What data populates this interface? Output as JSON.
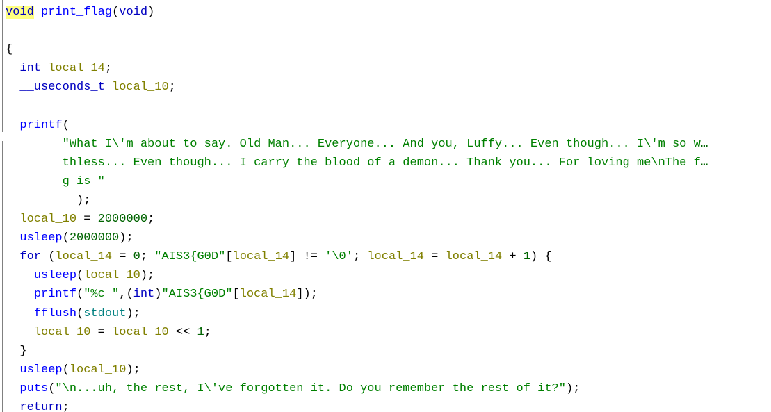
{
  "view": {
    "name": "decompiled-function-listing",
    "language": "c",
    "background_color": "#ffffff",
    "highlight_color": "#ffff80",
    "guide_rail_color": "#808080"
  },
  "colors": {
    "keyword": "#0000c0",
    "function": "#0000ff",
    "variable": "#808000",
    "string": "#008000",
    "number": "#006400",
    "global": "#008080",
    "punctuation": "#000000"
  },
  "function": {
    "return_type": "void",
    "name": "print_flag",
    "parameters": "(void)"
  },
  "lines": [
    {
      "index": 0,
      "indent": 0,
      "tokens": [
        {
          "t": "void",
          "c": "kw",
          "hl": true
        },
        {
          "t": " ",
          "c": "punct"
        },
        {
          "t": "print_flag",
          "c": "fn"
        },
        {
          "t": "(",
          "c": "punct"
        },
        {
          "t": "void",
          "c": "kw"
        },
        {
          "t": ")",
          "c": "punct"
        }
      ]
    },
    {
      "index": 1,
      "indent": 0,
      "tokens": []
    },
    {
      "index": 2,
      "indent": 0,
      "tokens": [
        {
          "t": "{",
          "c": "punct"
        }
      ]
    },
    {
      "index": 3,
      "indent": 1,
      "tokens": [
        {
          "t": "int",
          "c": "kw"
        },
        {
          "t": " ",
          "c": "punct"
        },
        {
          "t": "local_14",
          "c": "var"
        },
        {
          "t": ";",
          "c": "punct"
        }
      ]
    },
    {
      "index": 4,
      "indent": 1,
      "tokens": [
        {
          "t": "__useconds_t",
          "c": "kw"
        },
        {
          "t": " ",
          "c": "punct"
        },
        {
          "t": "local_10",
          "c": "var"
        },
        {
          "t": ";",
          "c": "punct"
        }
      ]
    },
    {
      "index": 5,
      "indent": 0,
      "tokens": []
    },
    {
      "index": 6,
      "indent": 1,
      "tokens": [
        {
          "t": "printf",
          "c": "fn"
        },
        {
          "t": "(",
          "c": "punct"
        }
      ]
    },
    {
      "index": 7,
      "indent": 4,
      "tokens": [
        {
          "t": "\"What I\\'m about to say. Old Man... Everyone... And you, Luffy... Even though... I\\'m so w",
          "c": "str"
        },
        {
          "t": "…",
          "c": "ellipsis"
        }
      ]
    },
    {
      "index": 8,
      "indent": 4,
      "tokens": [
        {
          "t": "thless... Even though... I carry the blood of a demon... Thank you... For loving me\\nThe f",
          "c": "str"
        },
        {
          "t": "…",
          "c": "ellipsis"
        }
      ]
    },
    {
      "index": 9,
      "indent": 4,
      "tokens": [
        {
          "t": "g is \"",
          "c": "str"
        }
      ]
    },
    {
      "index": 10,
      "indent": 5,
      "tokens": [
        {
          "t": ")",
          "c": "punct"
        },
        {
          "t": ";",
          "c": "punct"
        }
      ]
    },
    {
      "index": 11,
      "indent": 1,
      "tokens": [
        {
          "t": "local_10",
          "c": "var"
        },
        {
          "t": " = ",
          "c": "punct"
        },
        {
          "t": "2000000",
          "c": "num"
        },
        {
          "t": ";",
          "c": "punct"
        }
      ]
    },
    {
      "index": 12,
      "indent": 1,
      "tokens": [
        {
          "t": "usleep",
          "c": "fn"
        },
        {
          "t": "(",
          "c": "punct"
        },
        {
          "t": "2000000",
          "c": "num"
        },
        {
          "t": ");",
          "c": "punct"
        }
      ]
    },
    {
      "index": 13,
      "indent": 1,
      "tokens": [
        {
          "t": "for",
          "c": "kw"
        },
        {
          "t": " (",
          "c": "punct"
        },
        {
          "t": "local_14",
          "c": "var"
        },
        {
          "t": " = ",
          "c": "punct"
        },
        {
          "t": "0",
          "c": "num"
        },
        {
          "t": "; ",
          "c": "punct"
        },
        {
          "t": "\"AIS3{G0D\"",
          "c": "str"
        },
        {
          "t": "[",
          "c": "punct"
        },
        {
          "t": "local_14",
          "c": "var"
        },
        {
          "t": "] != ",
          "c": "punct"
        },
        {
          "t": "'\\0'",
          "c": "str"
        },
        {
          "t": "; ",
          "c": "punct"
        },
        {
          "t": "local_14",
          "c": "var"
        },
        {
          "t": " = ",
          "c": "punct"
        },
        {
          "t": "local_14",
          "c": "var"
        },
        {
          "t": " + ",
          "c": "punct"
        },
        {
          "t": "1",
          "c": "num"
        },
        {
          "t": ") {",
          "c": "punct"
        }
      ]
    },
    {
      "index": 14,
      "indent": 2,
      "tokens": [
        {
          "t": "usleep",
          "c": "fn"
        },
        {
          "t": "(",
          "c": "punct"
        },
        {
          "t": "local_10",
          "c": "var"
        },
        {
          "t": ");",
          "c": "punct"
        }
      ]
    },
    {
      "index": 15,
      "indent": 2,
      "tokens": [
        {
          "t": "printf",
          "c": "fn"
        },
        {
          "t": "(",
          "c": "punct"
        },
        {
          "t": "\"%c \"",
          "c": "str"
        },
        {
          "t": ",(",
          "c": "punct"
        },
        {
          "t": "int",
          "c": "kw"
        },
        {
          "t": ")",
          "c": "punct"
        },
        {
          "t": "\"AIS3{G0D\"",
          "c": "str"
        },
        {
          "t": "[",
          "c": "punct"
        },
        {
          "t": "local_14",
          "c": "var"
        },
        {
          "t": "]);",
          "c": "punct"
        }
      ]
    },
    {
      "index": 16,
      "indent": 2,
      "tokens": [
        {
          "t": "fflush",
          "c": "fn"
        },
        {
          "t": "(",
          "c": "punct"
        },
        {
          "t": "stdout",
          "c": "global"
        },
        {
          "t": ");",
          "c": "punct"
        }
      ]
    },
    {
      "index": 17,
      "indent": 2,
      "tokens": [
        {
          "t": "local_10",
          "c": "var"
        },
        {
          "t": " = ",
          "c": "punct"
        },
        {
          "t": "local_10",
          "c": "var"
        },
        {
          "t": " << ",
          "c": "punct"
        },
        {
          "t": "1",
          "c": "num"
        },
        {
          "t": ";",
          "c": "punct"
        }
      ]
    },
    {
      "index": 18,
      "indent": 1,
      "tokens": [
        {
          "t": "}",
          "c": "punct"
        }
      ]
    },
    {
      "index": 19,
      "indent": 1,
      "tokens": [
        {
          "t": "usleep",
          "c": "fn"
        },
        {
          "t": "(",
          "c": "punct"
        },
        {
          "t": "local_10",
          "c": "var"
        },
        {
          "t": ");",
          "c": "punct"
        }
      ]
    },
    {
      "index": 20,
      "indent": 1,
      "tokens": [
        {
          "t": "puts",
          "c": "fn"
        },
        {
          "t": "(",
          "c": "punct"
        },
        {
          "t": "\"\\n...uh, the rest, I\\'ve forgotten it. Do you remember the rest of it?\"",
          "c": "str"
        },
        {
          "t": ");",
          "c": "punct"
        }
      ]
    },
    {
      "index": 21,
      "indent": 1,
      "tokens": [
        {
          "t": "return",
          "c": "kw"
        },
        {
          "t": ";",
          "c": "punct"
        }
      ]
    }
  ]
}
